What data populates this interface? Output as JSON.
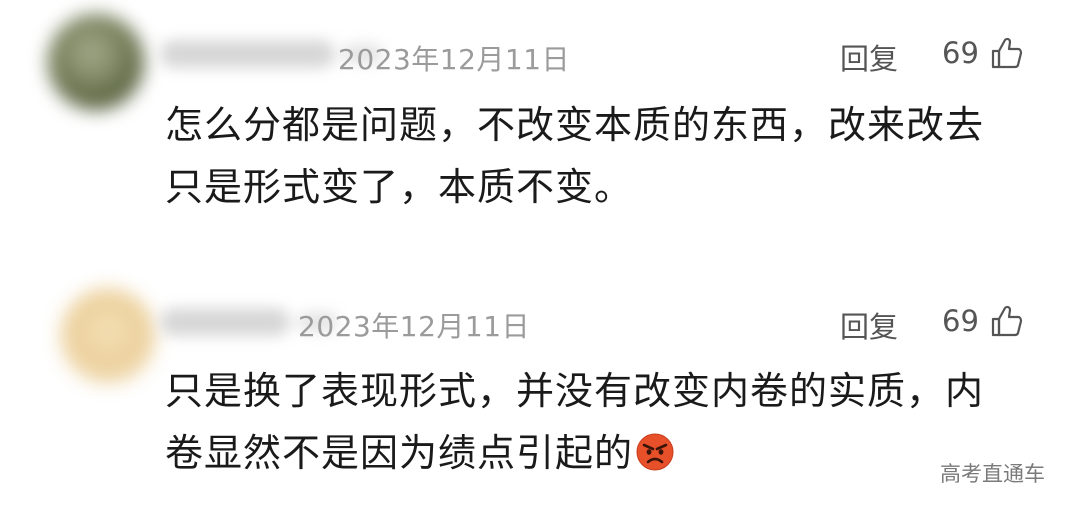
{
  "comments": [
    {
      "timestamp": "2023年12月11日",
      "reply_label": "回复",
      "like_count": "69",
      "body_lines": [
        "怎么分都是问题，不改变本质的东西，改来改去",
        "只是形式变了，本质不变。"
      ]
    },
    {
      "timestamp": "2023年12月11日",
      "reply_label": "回复",
      "like_count": "69",
      "body_lines": [
        "只是换了表现形式，并没有改变内卷的实质，内",
        "卷显然不是因为绩点引起的"
      ],
      "trailing_emoji": "angry-face-icon"
    }
  ],
  "watermark": "高考直通车",
  "colors": {
    "meta_text": "#9b9b9b",
    "action_text": "#555555",
    "body_text": "#1a1a1a",
    "emoji": "#e8502a"
  }
}
